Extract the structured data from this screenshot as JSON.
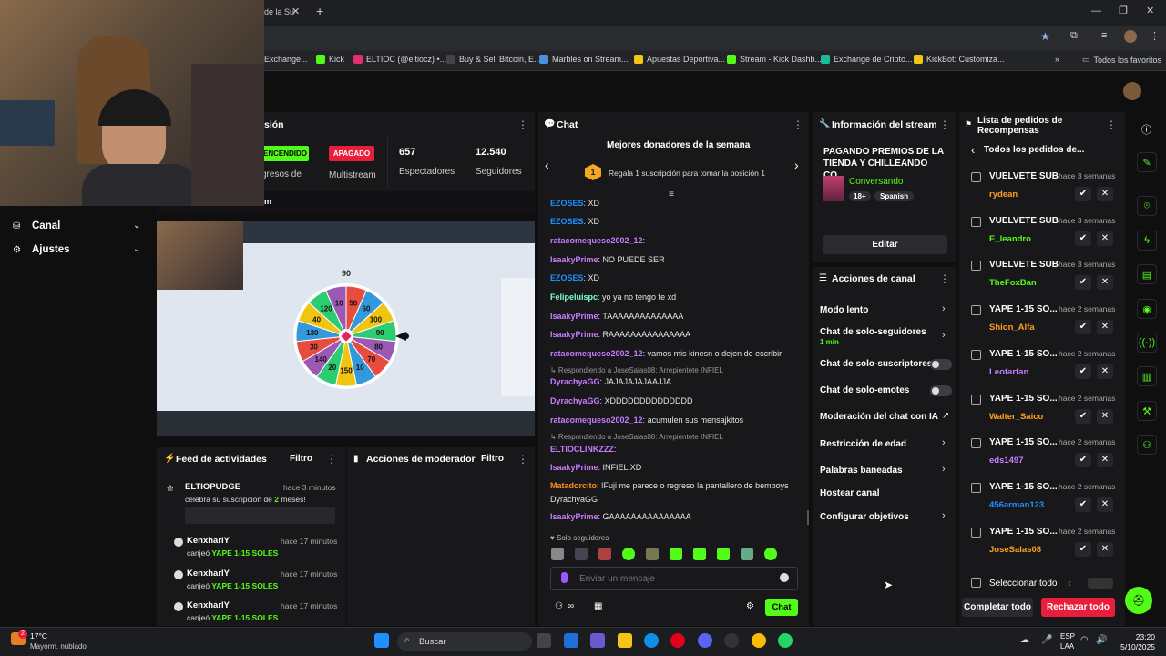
{
  "browser": {
    "tab_partial": "de la Su",
    "bookmarks": [
      "Exchange...",
      "Kick",
      "ELTIOC (@eltiocz) •...",
      "Buy & Sell Bitcoin, E...",
      "Marbles on Stream...",
      "Apuestas Deportiva...",
      "Stream - Kick Dashb...",
      "Exchange de Cripto...",
      "KickBot: Customiza..."
    ],
    "all_bookmarks": "Todos los favoritos"
  },
  "left_nav": {
    "items": [
      "Canal",
      "Ajustes"
    ]
  },
  "session": {
    "title_partial": "sión",
    "status_live": "ENCENDIDO",
    "status_multistream": "APAGADO",
    "multistream_label": "Multistream",
    "ingresos_partial": "gresos de",
    "viewers": "657",
    "viewers_label": "Espectadores",
    "followers": "12.540",
    "followers_label": "Seguidores",
    "tiny_m": "m"
  },
  "preview": {
    "wheel_top": "90",
    "wheel_numbers": [
      "50",
      "60",
      "100",
      "90",
      "80",
      "70",
      "10",
      "150",
      "20",
      "140",
      "30",
      "130",
      "40",
      "120",
      "10"
    ],
    "pointer_value": "90"
  },
  "activity": {
    "title": "Feed de actividades",
    "filter": "Filtro",
    "items": [
      {
        "user": "ELTIOPUDGE",
        "time": "hace 3 minutos",
        "pre": "celebra su suscripción de ",
        "count": "2",
        "post": " meses!"
      },
      {
        "user": "KenxharlY",
        "time": "hace 17 minutos",
        "pre": "canjeó ",
        "reward": "YAPE 1-15 SOLES"
      },
      {
        "user": "KenxharlY",
        "time": "hace 17 minutos",
        "pre": "canjeó ",
        "reward": "YAPE 1-15 SOLES"
      },
      {
        "user": "KenxharlY",
        "time": "hace 17 minutos",
        "pre": "canjeó ",
        "reward": "YAPE 1-15 SOLES"
      }
    ]
  },
  "mod": {
    "title": "Acciones de moderador",
    "filter": "Filtro"
  },
  "chat": {
    "title": "Chat",
    "donors_title": "Mejores donadores de la semana",
    "donors_rank": "1",
    "donors_text": "Regala 1 suscripción para tomar la posición 1",
    "messages": [
      {
        "user": "EZOSES",
        "color": "#1e90ff",
        "text": ": XD"
      },
      {
        "user": "EZOSES",
        "color": "#1e90ff",
        "text": ": XD"
      },
      {
        "user": "ratacomequeso2002_12",
        "color": "#c77dff",
        "text": ":"
      },
      {
        "user": "IsaakyPrime",
        "color": "#c77dff",
        "text": ": NO PUEDE SER"
      },
      {
        "user": "EZOSES",
        "color": "#1e90ff",
        "text": ": XD"
      },
      {
        "user": "Felipeluispc",
        "color": "#7fffd4",
        "text": ": yo ya no tengo fe xd"
      },
      {
        "user": "IsaakyPrime",
        "color": "#c77dff",
        "text": ": TAAAAAAAAAAAAAA"
      },
      {
        "user": "IsaakyPrime",
        "color": "#c77dff",
        "text": ": RAAAAAAAAAAAAAAA"
      },
      {
        "user": "ratacomequeso2002_12",
        "color": "#c77dff",
        "text": ": vamos mis kinesn o dejen de escribir"
      },
      {
        "reply": "Respondiendo a JoseSalas08: Arrepientete INFIEL"
      },
      {
        "user": "DyrachyaGG",
        "color": "#c77dff",
        "text": ": JAJAJAJAJAAJJA"
      },
      {
        "user": "DyrachyaGG",
        "color": "#c77dff",
        "text": ": XDDDDDDDDDDDDDD"
      },
      {
        "user": "ratacomequeso2002_12",
        "color": "#c77dff",
        "text": ": acumulen sus mensajkitos"
      },
      {
        "reply": "Respondiendo a JoseSalas08: Arrepientete INFIEL"
      },
      {
        "user": "ELTIOCLINKZZZ",
        "color": "#c77dff",
        "text": ":"
      },
      {
        "user": "IsaakyPrime",
        "color": "#c77dff",
        "text": ": INFIEL XD"
      },
      {
        "user": "Matadorcito",
        "color": "#ff8c1a",
        "text": ": !Fuji me parece o regreso la pantallero de bemboys"
      },
      {
        "cont": "DyrachyaGG"
      },
      {
        "user": "IsaakyPrime",
        "color": "#c77dff",
        "text": ": GAAAAAAAAAAAAAAA"
      }
    ],
    "followers_only": "Solo seguidores",
    "placeholder": "Enviar un mensaje",
    "send": "Chat"
  },
  "stream_info": {
    "title": "Información del stream",
    "stream_title": "PAGANDO PREMIOS DE LA TIENDA Y CHILLEANDO CO...",
    "category": "Conversando",
    "tags": [
      "18+",
      "Spanish"
    ],
    "edit": "Editar"
  },
  "channel_actions": {
    "title": "Acciones de canal",
    "items": [
      {
        "label": "Modo lento",
        "type": "arrow"
      },
      {
        "label": "Chat de solo-seguidores",
        "sub": "1 min",
        "type": "arrow"
      },
      {
        "label": "Chat de solo-suscriptores",
        "type": "toggle"
      },
      {
        "label": "Chat de solo-emotes",
        "type": "toggle"
      },
      {
        "label": "Moderación del chat con IA",
        "type": "ext"
      },
      {
        "label": "Restricción de edad",
        "type": "arrow"
      },
      {
        "label": "Palabras baneadas",
        "type": "arrow"
      },
      {
        "label": "Hostear canal",
        "type": "none"
      },
      {
        "label": "Configurar objetivos",
        "type": "arrow"
      }
    ]
  },
  "rewards": {
    "title_line1": "Lista de pedidos de",
    "title_line2": "Recompensas",
    "back": "Todos los pedidos de...",
    "items": [
      {
        "title": "VUELVETE SUB",
        "time": "hace 3 semanas",
        "user": "rydean",
        "color": "#ff9f1c"
      },
      {
        "title": "VUELVETE SUB",
        "time": "hace 3 semanas",
        "user": "E_leandro",
        "color": "#53fc18"
      },
      {
        "title": "VUELVETE SUB",
        "time": "hace 3 semanas",
        "user": "TheFoxBan",
        "color": "#53fc18"
      },
      {
        "title": "YAPE 1-15 SO...",
        "time": "hace 2 semanas",
        "user": "Shion_Alfa",
        "color": "#ff9f1c"
      },
      {
        "title": "YAPE 1-15 SO...",
        "time": "hace 2 semanas",
        "user": "Leofarfan",
        "color": "#c77dff"
      },
      {
        "title": "YAPE 1-15 SO...",
        "time": "hace 2 semanas",
        "user": "Walter_Saico",
        "color": "#ff9f1c"
      },
      {
        "title": "YAPE 1-15 SO...",
        "time": "hace 2 semanas",
        "user": "eds1497",
        "color": "#c77dff"
      },
      {
        "title": "YAPE 1-15 SO...",
        "time": "hace 2 semanas",
        "user": "456arman123",
        "color": "#1e90ff"
      },
      {
        "title": "YAPE 1-15 SO...",
        "time": "hace 2 semanas",
        "user": "JoseSalas08",
        "color": "#ff9f1c"
      }
    ],
    "select_all": "Seleccionar todo",
    "complete_all": "Completar todo",
    "reject_all": "Rechazar todo"
  },
  "taskbar": {
    "weather_temp": "17°C",
    "weather_desc": "Mayorm. nublado",
    "notif": "2",
    "search": "Buscar",
    "lang1": "ESP",
    "lang2": "LAA",
    "time": "23:20",
    "date": "5/10/2025"
  },
  "colors": {
    "accent": "#53fc18",
    "reject": "#e91e3c"
  }
}
